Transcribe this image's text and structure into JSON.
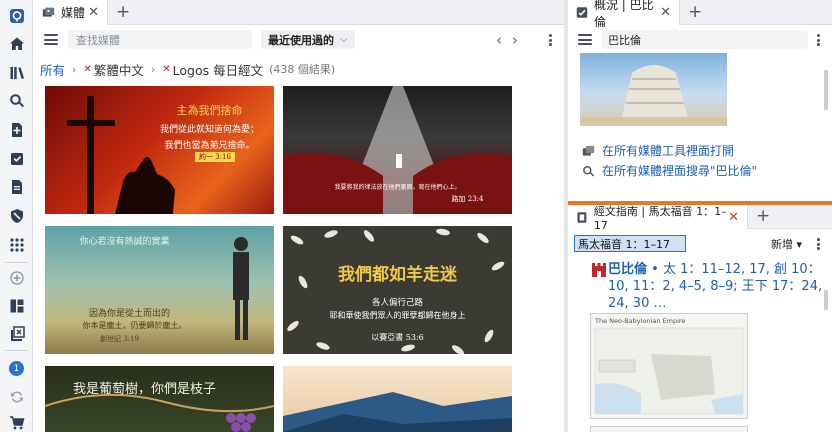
{
  "rail": {
    "icons": [
      "logos-logo-icon",
      "home-icon",
      "library-icon",
      "search-icon",
      "add-document-icon",
      "checklist-icon",
      "document-icon",
      "shield-icon",
      "apps-icon",
      "add-circle-icon",
      "layout-icon",
      "close-panels-icon",
      "notification-icon",
      "sync-icon",
      "cart-icon"
    ],
    "notification_count": "1"
  },
  "media": {
    "tab_title": "媒體",
    "search_placeholder": "查找媒體",
    "sort_label": "最近使用過的",
    "breadcrumb": {
      "all": "所有",
      "filter1": "繁體中文",
      "filter2": "Logos 每日經文",
      "count": "(438 個結果)"
    },
    "thumbs": [
      {
        "title": "主為我們捨命",
        "line2": "我們從此就知道何為愛；",
        "line3": "我們也當為弟兄捨命。",
        "ref": "約一 3:16",
        "colors": [
          "#a11a12",
          "#e05a1c"
        ]
      },
      {
        "title": "",
        "line2": "我要將我的律法放在他們裏面，寫在他們心上。",
        "line3": "",
        "ref": "路加 23:4",
        "colors": [
          "#2d2d2d",
          "#7a1010"
        ]
      },
      {
        "title": "你心若沒有熱誠的實業",
        "line2": "因為你是從土而出的",
        "line3": "你本是塵土，仍要歸於塵土。",
        "ref": "創世記 3:19",
        "colors": [
          "#6aa6a6",
          "#b9b47a"
        ]
      },
      {
        "title": "我們都如羊走迷",
        "line2": "各人偏行己路",
        "line3": "耶和華使我們眾人的罪孽都歸在他身上",
        "ref": "以賽亞書 53:6",
        "colors": [
          "#3a3a34",
          "#4a4a40"
        ]
      },
      {
        "title": "我是葡萄樹，你們是枝子",
        "line2": "",
        "line3": "",
        "ref": "",
        "colors": [
          "#2b3320",
          "#3a4a28"
        ]
      },
      {
        "title": "",
        "line2": "",
        "line3": "",
        "ref": "",
        "colors": [
          "#f3dcc0",
          "#c98a4a"
        ]
      }
    ]
  },
  "outline": {
    "tab_title": "概況 | 巴比倫",
    "search_value": "巴比倫",
    "link_open": "在所有媒體工具裡面打開",
    "link_search": "在所有媒體裡面搜尋\"巴比倫\"",
    "guide_tab_title": "經文指南 | 馬太福音 1：1–17",
    "reference": "馬太福音 1：1–17",
    "new_label": "新增",
    "entry_title": "巴比倫",
    "entry_refs": "• 太 1：11–12, 17, 創 10：10, 11：2, 4–5, 8–9; 王下 17：24, 24, 30 …",
    "map_title": "The Neo-Babylonian Empire"
  }
}
